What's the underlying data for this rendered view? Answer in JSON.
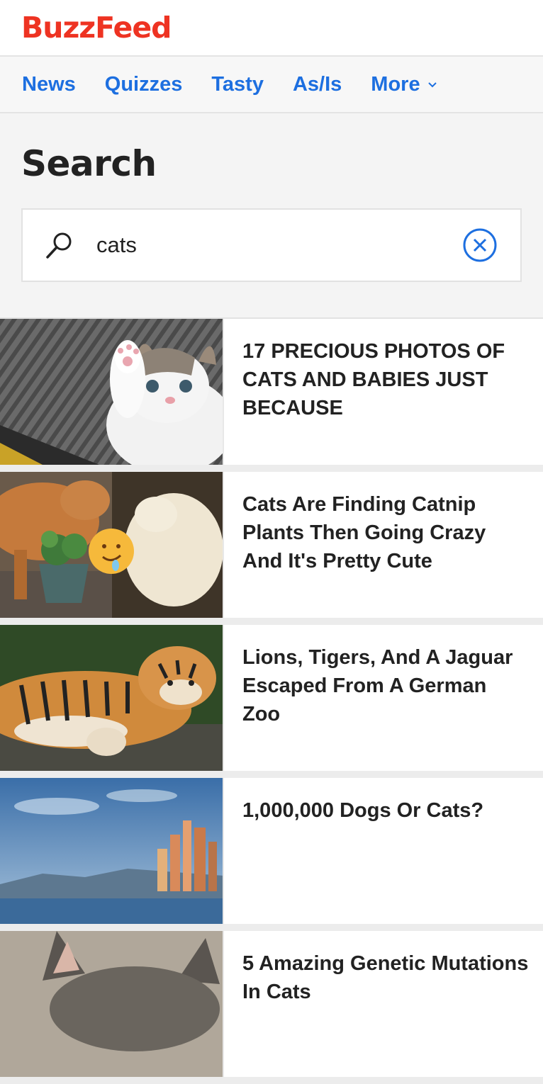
{
  "header": {
    "logo": "BuzzFeed",
    "brand_color": "#ee3322"
  },
  "nav": {
    "items": [
      "News",
      "Quizzes",
      "Tasty",
      "As/Is",
      "More"
    ],
    "link_color": "#1d6fe0"
  },
  "search": {
    "title": "Search",
    "query": "cats"
  },
  "results": [
    {
      "title": "17 PRECIOUS PHOTOS OF CATS AND BABIES JUST BECAUSE",
      "image": "kitten waving paw"
    },
    {
      "title": "Cats Are Finding Catnip Plants Then Going Crazy And It's Pretty Cute",
      "image": "cats with catnip plant and emoji"
    },
    {
      "title": "Lions, Tigers, And A Jaguar Escaped From A German Zoo",
      "image": "tiger resting on log"
    },
    {
      "title": "1,000,000 Dogs Or Cats?",
      "image": "animated city skyline"
    },
    {
      "title": "5 Amazing Genetic Mutations In Cats",
      "image": "cat ears"
    }
  ]
}
